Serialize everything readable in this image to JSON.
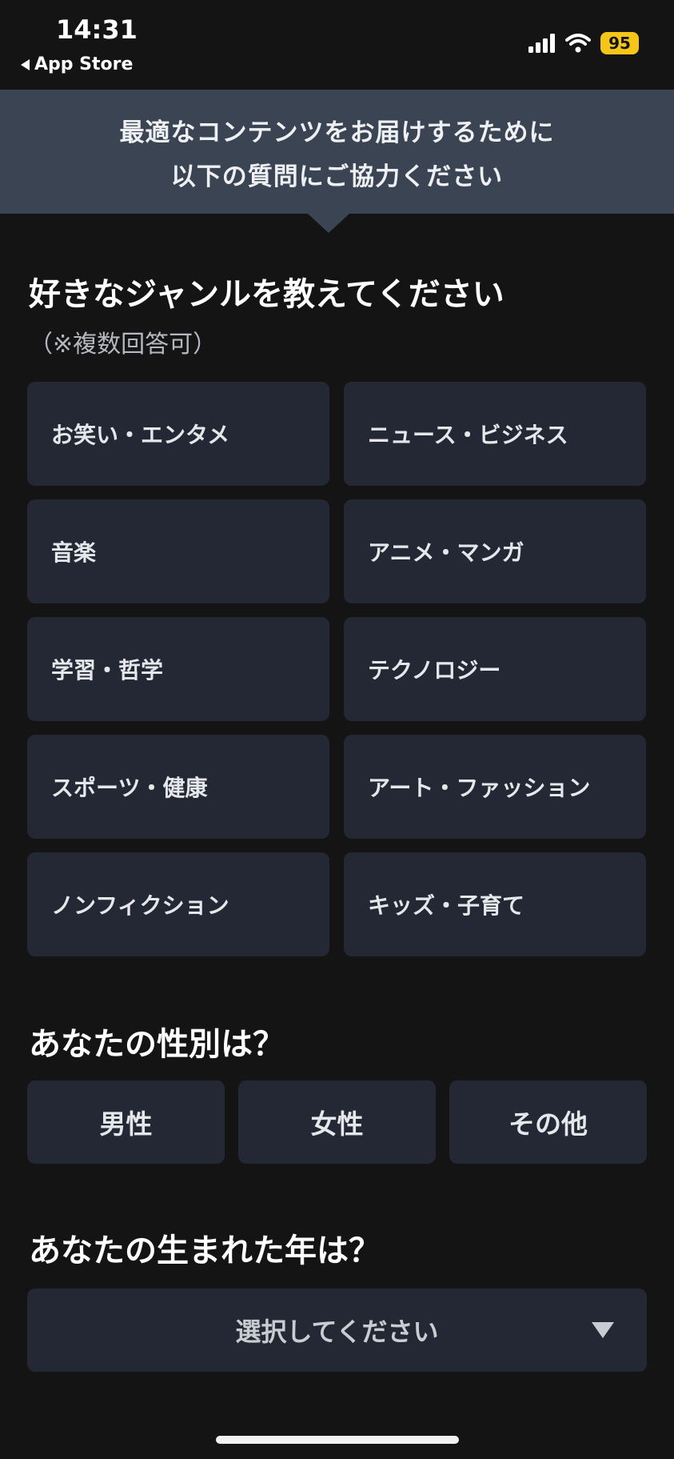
{
  "status_bar": {
    "time": "14:31",
    "back_label": "App Store",
    "battery": "95",
    "battery_color": "#f5c518"
  },
  "banner": {
    "line1": "最適なコンテンツをお届けするために",
    "line2": "以下の質問にご協力ください"
  },
  "genre_section": {
    "title": "好きなジャンルを教えてください",
    "note": "（※複数回答可）",
    "options": [
      "お笑い・エンタメ",
      "ニュース・ビジネス",
      "音楽",
      "アニメ・マンガ",
      "学習・哲学",
      "テクノロジー",
      "スポーツ・健康",
      "アート・ファッション",
      "ノンフィクション",
      "キッズ・子育て"
    ]
  },
  "gender_section": {
    "title": "あなたの性別は？",
    "options": [
      "男性",
      "女性",
      "その他"
    ]
  },
  "birth_year_section": {
    "title": "あなたの生まれた年は？",
    "select_placeholder": "選択してください"
  },
  "colors": {
    "background": "#141414",
    "banner": "#3b4452",
    "option_card": "#242834"
  },
  "icons": {
    "back": "triangle-left",
    "signal": "cellular-bars",
    "wifi": "wifi-arcs",
    "dropdown": "triangle-down"
  }
}
